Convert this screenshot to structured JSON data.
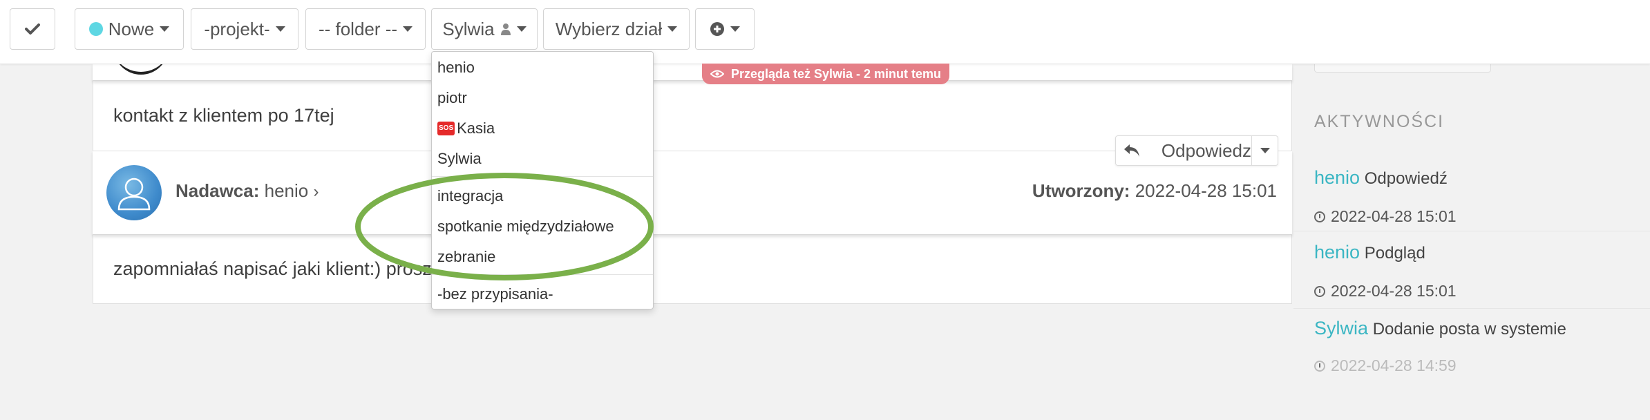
{
  "toolbar": {
    "status_label": "Nowe",
    "project_label": "-projekt-",
    "folder_label": "-- folder --",
    "assignee_label": "Sylwia",
    "department_label": "Wybierz dział"
  },
  "viewer_badge": "Przegląda też Sylwia - 2 minut temu",
  "messages": {
    "first_body": "kontakt z klientem po 17tej",
    "second_body": "zapomniałaś napisać jaki klient:) prosz",
    "sender_prefix": "Nadawca:",
    "sender_name": "henio",
    "created_prefix": "Utworzony:",
    "created_value": "2022-04-28 15:01",
    "reply_label": "Odpowiedz"
  },
  "dropdown": {
    "users": [
      "henio",
      "piotr",
      "Kasia",
      "Sylwia"
    ],
    "sos_label": "SOS",
    "groups": [
      "integracja",
      "spotkanie międzydziałowe",
      "zebranie"
    ],
    "unassigned": "-bez przypisania-"
  },
  "sidebar": {
    "title": "AKTYWNOŚCI",
    "activities": [
      {
        "user": "henio",
        "action": "Odpowiedź",
        "time": "2022-04-28 15:01"
      },
      {
        "user": "henio",
        "action": "Podgląd",
        "time": "2022-04-28 15:01"
      },
      {
        "user": "Sylwia",
        "action": "Dodanie posta w systemie",
        "time": "2022-04-28 14:59"
      }
    ]
  },
  "colors": {
    "accent": "#3bb6c3",
    "status_dot": "#5ed7e3",
    "badge": "#e57f87",
    "annotation": "#7ab04a"
  }
}
